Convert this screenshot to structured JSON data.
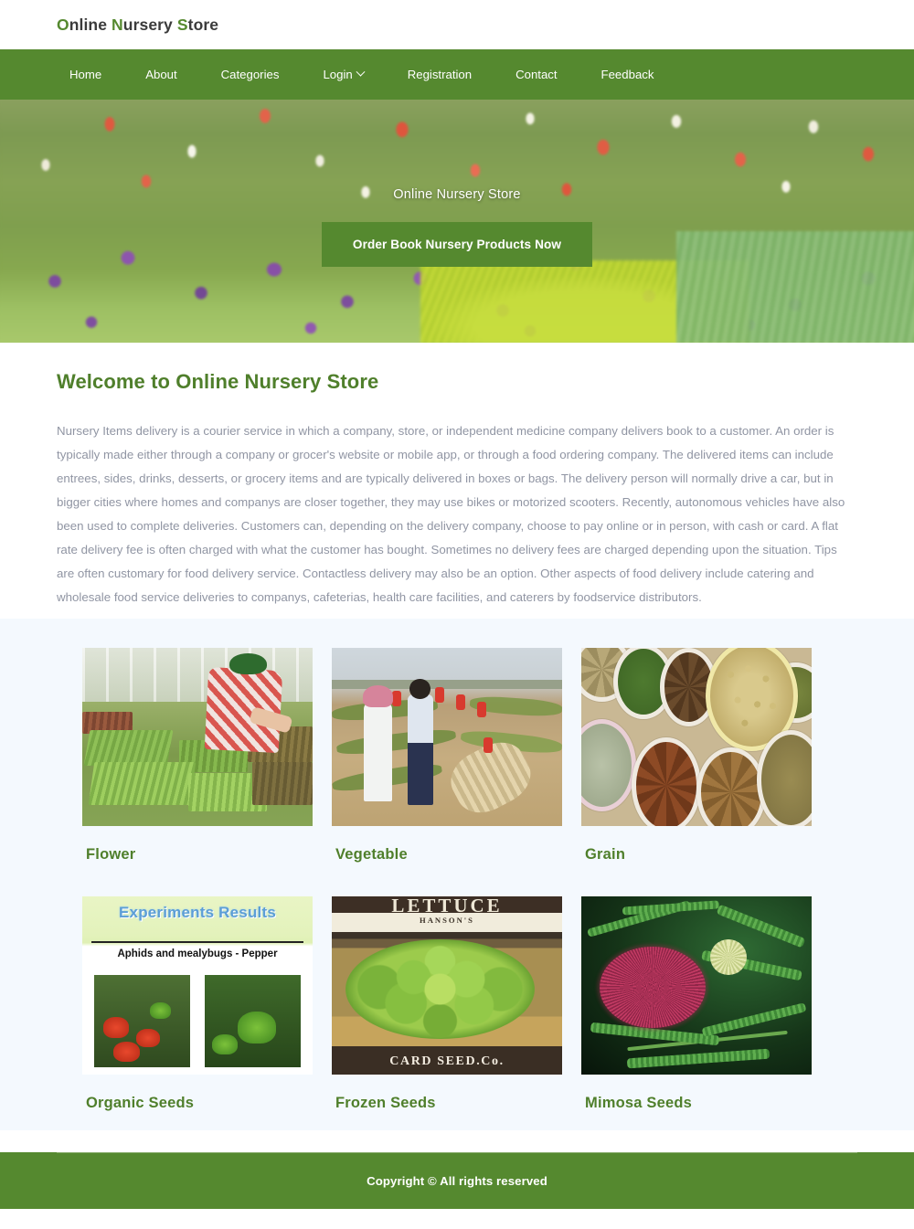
{
  "theme": {
    "brand_green": "#55892F",
    "heading_green": "#4F7F2B",
    "body_gray": "#9095A3",
    "cards_bg": "#F4F9FE",
    "white": "#FFFFFF"
  },
  "header": {
    "brand": {
      "full": "Online Nursery Store",
      "parts": [
        {
          "cap": "O",
          "rest": "nline "
        },
        {
          "cap": "N",
          "rest": "ursery "
        },
        {
          "cap": "S",
          "rest": "tore"
        }
      ]
    }
  },
  "nav": {
    "items": [
      {
        "label": "Home",
        "has_caret": false
      },
      {
        "label": "About",
        "has_caret": false
      },
      {
        "label": "Categories",
        "has_caret": false
      },
      {
        "label": "Login",
        "has_caret": true
      },
      {
        "label": "Registration",
        "has_caret": false
      },
      {
        "label": "Contact",
        "has_caret": false
      },
      {
        "label": "Feedback",
        "has_caret": false
      }
    ]
  },
  "hero": {
    "title": "Online Nursery Store",
    "cta_label": "Order Book Nursery Products Now",
    "image_alt": "flower-field-banner"
  },
  "welcome": {
    "title": "Welcome to Online Nursery Store",
    "body": "Nursery Items delivery is a courier service in which a company, store, or independent medicine company delivers book to a customer. An order is typically made either through a company or grocer's website or mobile app, or through a food ordering company. The delivered items can include entrees, sides, drinks, desserts, or grocery items and are typically delivered in boxes or bags. The delivery person will normally drive a car, but in bigger cities where homes and companys are closer together, they may use bikes or motorized scooters. Recently, autonomous vehicles have also been used to complete deliveries. Customers can, depending on the delivery company, choose to pay online or in person, with cash or card. A flat rate delivery fee is often charged with what the customer has bought. Sometimes no delivery fees are charged depending upon the situation. Tips are often customary for food delivery service. Contactless delivery may also be an option. Other aspects of food delivery include catering and wholesale food service deliveries to companys, cafeterias, health care facilities, and caterers by foodservice distributors."
  },
  "categories": {
    "items": [
      {
        "label": "Flower",
        "image_alt": "greenhouse-seedlings-photo"
      },
      {
        "label": "Vegetable",
        "image_alt": "farm-field-workers-photo"
      },
      {
        "label": "Grain",
        "image_alt": "grain-sacks-photo"
      },
      {
        "label": "Organic Seeds",
        "image_alt": "experiments-results-poster",
        "poster": {
          "title": "Experiments Results",
          "subtitle": "Aphids and mealybugs - Pepper"
        }
      },
      {
        "label": "Frozen Seeds",
        "image_alt": "vintage-lettuce-seed-packet",
        "packet": {
          "top": "LETTUCE",
          "band": "HANSON'S",
          "bottom": "CARD SEED.Co."
        }
      },
      {
        "label": "Mimosa Seeds",
        "image_alt": "mimosa-flower-photo"
      }
    ]
  },
  "footer": {
    "text": "Copyright © All rights reserved"
  }
}
